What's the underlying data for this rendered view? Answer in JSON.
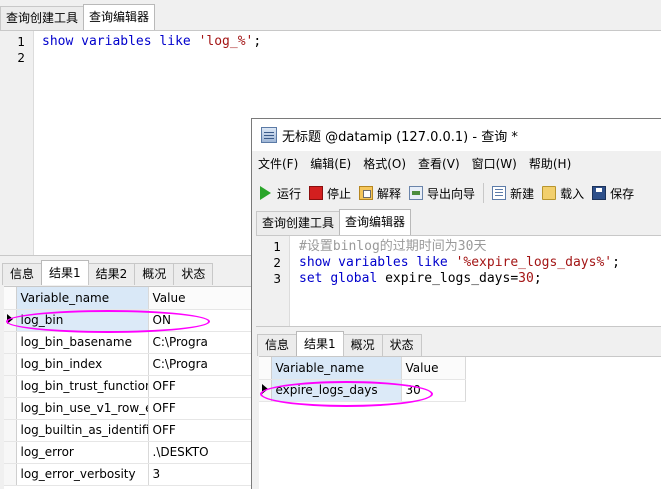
{
  "background_window": {
    "tabs": [
      "查询创建工具",
      "查询编辑器"
    ],
    "active_tab": 1,
    "editor": {
      "line_numbers": [
        "1",
        "2"
      ],
      "lines": [
        [
          {
            "t": "show",
            "c": "kw"
          },
          {
            "t": " "
          },
          {
            "t": "variables",
            "c": "kw"
          },
          {
            "t": " "
          },
          {
            "t": "like",
            "c": "kw"
          },
          {
            "t": " "
          },
          {
            "t": "'log_%'",
            "c": "str"
          },
          {
            "t": ";"
          }
        ],
        []
      ]
    },
    "result_tabs": [
      "信息",
      "结果1",
      "结果2",
      "概况",
      "状态"
    ],
    "active_result_tab": 1,
    "grid": {
      "headers": [
        "Variable_name",
        "Value"
      ],
      "rows": [
        [
          "log_bin",
          "ON"
        ],
        [
          "log_bin_basename",
          "C:\\Progra"
        ],
        [
          "log_bin_index",
          "C:\\Progra"
        ],
        [
          "log_bin_trust_function",
          "OFF"
        ],
        [
          "log_bin_use_v1_row_e",
          "OFF"
        ],
        [
          "log_builtin_as_identifie",
          "OFF"
        ],
        [
          "log_error",
          ".\\DESKTO"
        ],
        [
          "log_error_verbosity",
          "3"
        ]
      ]
    }
  },
  "foreground_window": {
    "title": "无标题 @datamip (127.0.0.1) - 查询 *",
    "menu": [
      "文件(F)",
      "编辑(E)",
      "格式(O)",
      "查看(V)",
      "窗口(W)",
      "帮助(H)"
    ],
    "toolbar": {
      "run": "运行",
      "stop": "停止",
      "explain": "解释",
      "export": "导出向导",
      "new": "新建",
      "load": "载入",
      "save": "保存"
    },
    "tabs": [
      "查询创建工具",
      "查询编辑器"
    ],
    "active_tab": 1,
    "editor": {
      "line_numbers": [
        "1",
        "2",
        "3"
      ],
      "lines": [
        [
          {
            "t": "#设置binlog的过期时间为30天",
            "c": "cm"
          }
        ],
        [
          {
            "t": "show",
            "c": "kw"
          },
          {
            "t": " "
          },
          {
            "t": "variables",
            "c": "kw"
          },
          {
            "t": " "
          },
          {
            "t": "like",
            "c": "kw"
          },
          {
            "t": " "
          },
          {
            "t": "'%expire_logs_days%'",
            "c": "str"
          },
          {
            "t": ";"
          }
        ],
        [
          {
            "t": "set",
            "c": "kw"
          },
          {
            "t": " "
          },
          {
            "t": "global",
            "c": "kw"
          },
          {
            "t": " expire_logs_days="
          },
          {
            "t": "30",
            "c": "str"
          },
          {
            "t": ";"
          }
        ]
      ]
    },
    "result_tabs": [
      "信息",
      "结果1",
      "概况",
      "状态"
    ],
    "active_result_tab": 1,
    "grid": {
      "headers": [
        "Variable_name",
        "Value"
      ],
      "rows": [
        [
          "expire_logs_days",
          "30"
        ]
      ]
    }
  },
  "colors": {
    "keyword": "#0000cc",
    "string": "#a31515",
    "comment": "#9a9a9a",
    "highlight_oval": "#ff00ff"
  }
}
